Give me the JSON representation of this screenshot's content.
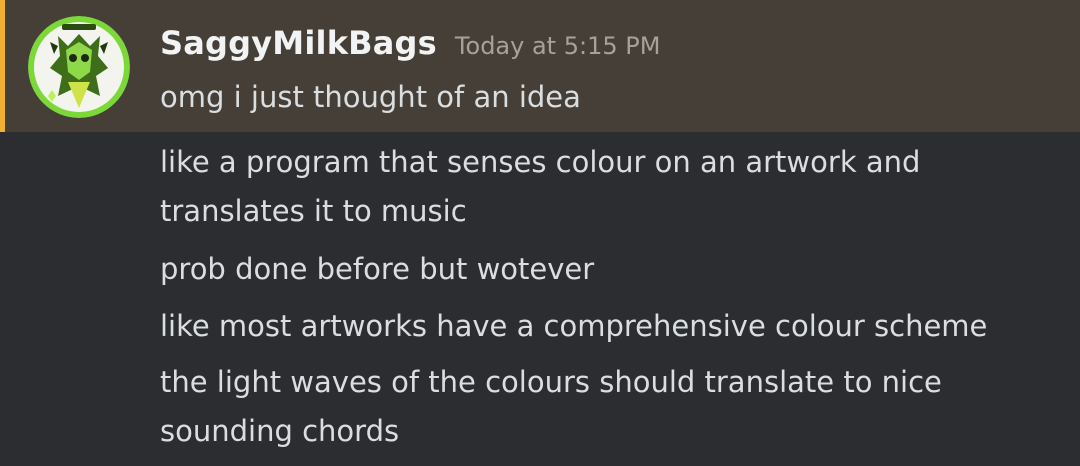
{
  "author": {
    "username": "SaggyMilkBags",
    "timestamp": "Today at 5:15 PM"
  },
  "colors": {
    "background": "#2b2d31",
    "highlight_background": "#463f37",
    "mention_bar": "#f0b132",
    "text": "#dbdee1",
    "username": "#f2f3f5",
    "timestamp": "#a7a19a"
  },
  "messages": [
    {
      "text": "omg i just thought of an idea"
    },
    {
      "text": "like a program that senses colour on an artwork and"
    },
    {
      "text": "translates it to music"
    },
    {
      "text": "prob done before but wotever"
    },
    {
      "text": "like most artworks have a comprehensive colour scheme"
    },
    {
      "text": "the light waves of the colours should translate to nice"
    },
    {
      "text": "sounding chords"
    }
  ]
}
